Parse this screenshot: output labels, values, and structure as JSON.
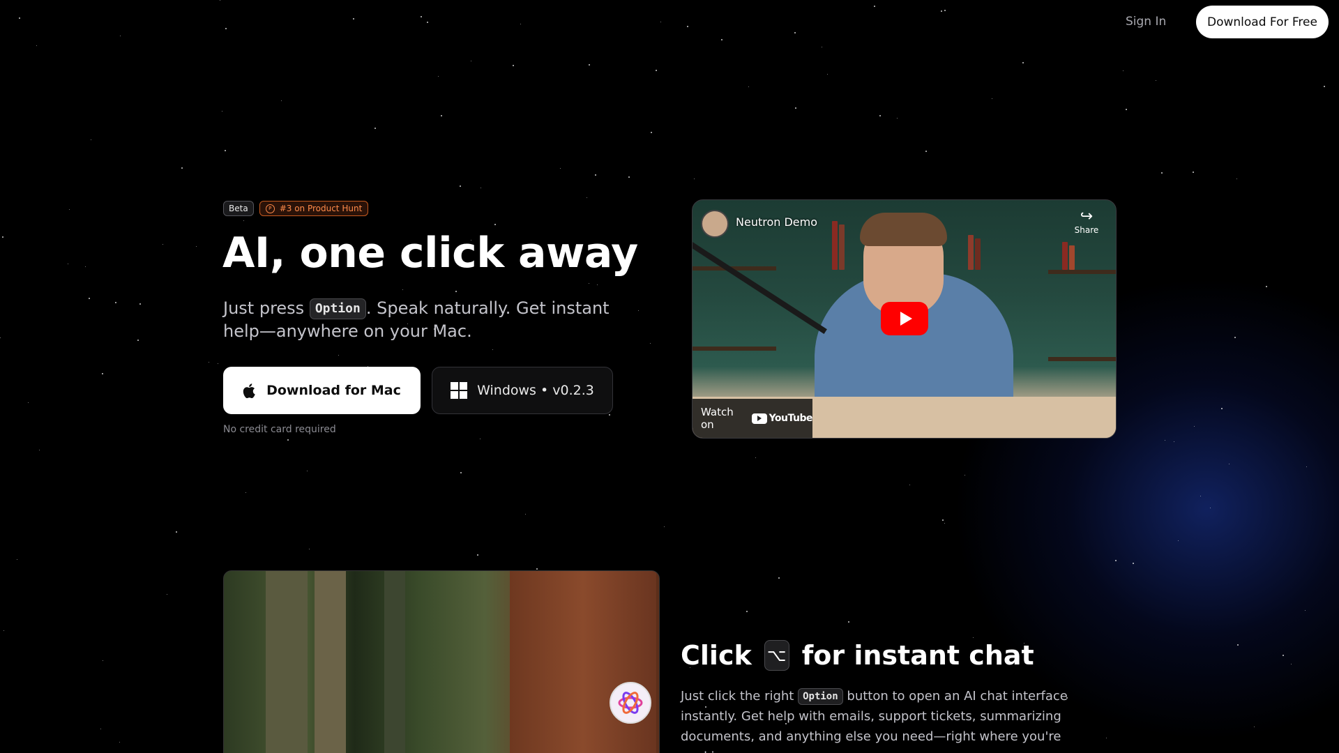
{
  "nav": {
    "signin_label": "Sign In",
    "download_label": "Download For Free"
  },
  "hero": {
    "badges": {
      "beta": "Beta",
      "product_hunt": "#3 on Product Hunt",
      "product_hunt_icon": "P"
    },
    "title": "AI, one click away",
    "subtitle_before": "Just press ",
    "subtitle_key": "Option",
    "subtitle_after": ". Speak naturally. Get instant help—anywhere on your Mac.",
    "mac_button_label": "Download for Mac",
    "windows_button_label": "Windows • v0.2.3",
    "note": "No credit card required"
  },
  "video": {
    "title": "Neutron Demo",
    "share_label": "Share",
    "watch_label": "Watch on",
    "youtube_label": "YouTube"
  },
  "feature": {
    "title_before": "Click",
    "title_key": "⌥",
    "title_after": "for instant chat",
    "body_before": "Just click the right ",
    "body_key": "Option",
    "body_after": " button to open an AI chat interface instantly. Get help with emails, support tickets, summarizing documents, and anything else you need—right where you're working."
  },
  "icons": [
    "apple-icon",
    "windows-icon",
    "play-icon",
    "share-icon",
    "youtube-icon",
    "product-hunt-icon",
    "app-logo-icon"
  ],
  "colors": {
    "accent_orange": "#ff8b4a",
    "youtube_red": "#ff0000",
    "background": "#000000",
    "glow_blue": "#1e3caa"
  }
}
